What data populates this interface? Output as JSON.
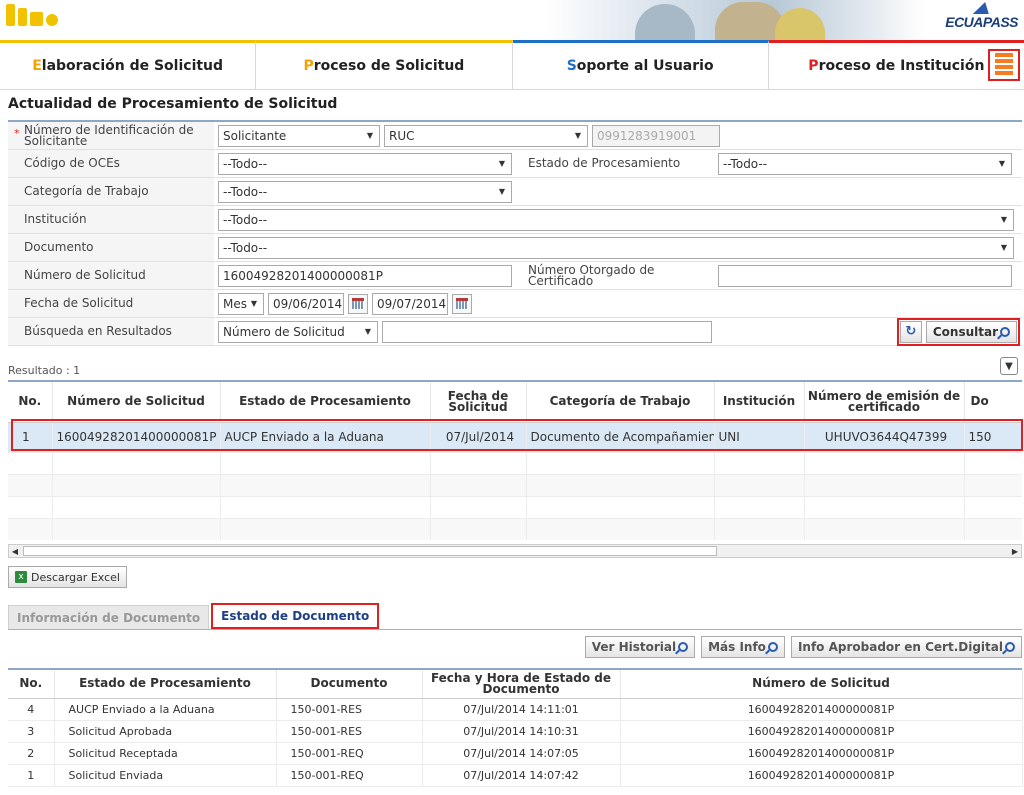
{
  "nav": {
    "items": [
      {
        "cap": "E",
        "rest": "laboración de Solicitud"
      },
      {
        "cap": "P",
        "rest": "roceso de Solicitud"
      },
      {
        "cap": "S",
        "rest": "oporte al Usuario"
      },
      {
        "cap": "P",
        "rest": "roceso de Institución"
      }
    ],
    "brand": "ECUAPASS"
  },
  "page_title": "Actualidad de Procesamiento de Solicitud",
  "form": {
    "id_label": "Número de Identificación de Solicitante",
    "id_type": "Solicitante",
    "id_doc_type": "RUC",
    "id_value": "0991283919001",
    "oce_label": "Código de OCEs",
    "oce_value": "--Todo--",
    "estado_label": "Estado de Procesamiento",
    "estado_value": "--Todo--",
    "categoria_label": "Categoría de Trabajo",
    "categoria_value": "--Todo--",
    "institucion_label": "Institución",
    "institucion_value": "--Todo--",
    "documento_label": "Documento",
    "documento_value": "--Todo--",
    "num_sol_label": "Número de Solicitud",
    "num_sol_value": "16004928201400000081P",
    "num_cert_label": "Número Otorgado de Certificado",
    "num_cert_value": "",
    "fecha_label": "Fecha de Solicitud",
    "fecha_unit": "Mes",
    "fecha_from": "09/06/2014",
    "fecha_to": "09/07/2014",
    "busqueda_label": "Búsqueda en Resultados",
    "busqueda_field": "Número de Solicitud",
    "busqueda_value": "",
    "consultar_label": "Consultar"
  },
  "results": {
    "label": "Resultado : 1",
    "columns": [
      "No.",
      "Número de Solicitud",
      "Estado de Procesamiento",
      "Fecha de Solicitud",
      "Categoría de Trabajo",
      "Institución",
      "Número de emisión de certificado",
      "Do"
    ],
    "rows": [
      [
        "1",
        "16004928201400000081P",
        "AUCP Enviado a la Aduana",
        "07/Jul/2014",
        "Documento de Acompañamiento",
        "UNI",
        "UHUVO3644Q47399",
        "150"
      ]
    ],
    "excel_label": "Descargar Excel"
  },
  "tabs": {
    "info": "Información de Documento",
    "estado": "Estado de Documento"
  },
  "doc_buttons": {
    "historial": "Ver Historial",
    "mas_info": "Más Info",
    "aprobador": "Info Aprobador en Cert.Digital"
  },
  "doc_table": {
    "columns": [
      "No.",
      "Estado de Procesamiento",
      "Documento",
      "Fecha y Hora de Estado de Documento",
      "Número de Solicitud"
    ],
    "rows": [
      [
        "4",
        "AUCP Enviado a la Aduana",
        "150-001-RES",
        "07/Jul/2014 14:11:01",
        "16004928201400000081P"
      ],
      [
        "3",
        "Solicitud Aprobada",
        "150-001-RES",
        "07/Jul/2014 14:10:31",
        "16004928201400000081P"
      ],
      [
        "2",
        "Solicitud Receptada",
        "150-001-REQ",
        "07/Jul/2014 14:07:05",
        "16004928201400000081P"
      ],
      [
        "1",
        "Solicitud Enviada",
        "150-001-REQ",
        "07/Jul/2014 14:07:42",
        "16004928201400000081P"
      ]
    ]
  },
  "colors": {
    "accent_yellow": "#f2c200",
    "accent_blue": "#1e6fc7",
    "accent_red": "#e02020",
    "selected_row": "#dbe8f6"
  }
}
